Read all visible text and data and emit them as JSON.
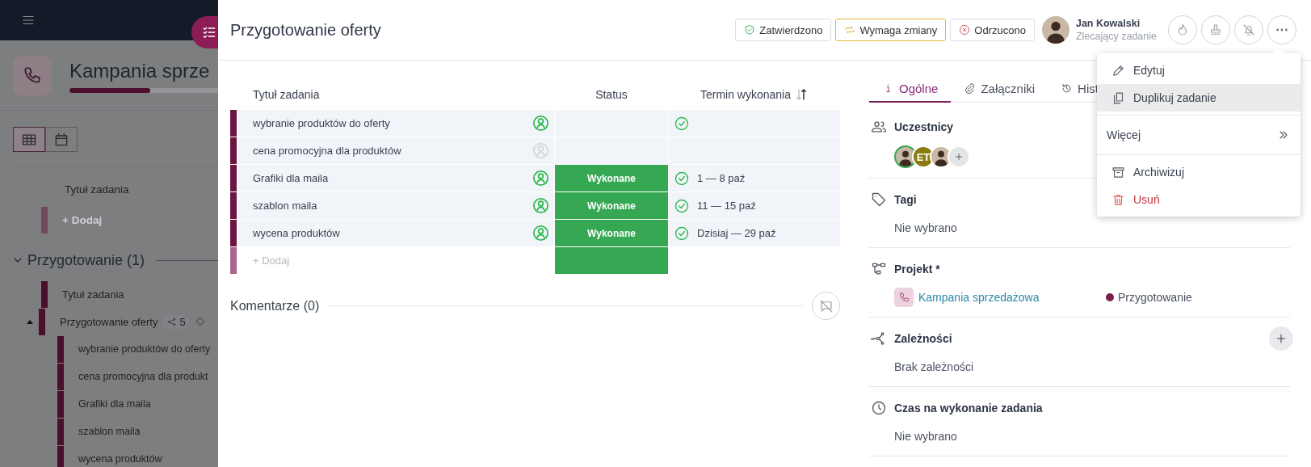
{
  "background": {
    "project_title": "Kampania sprze",
    "progress": {
      "level": 0.4
    },
    "views": [
      {
        "kind": "table",
        "selected": true
      },
      {
        "kind": "calendar",
        "selected": false
      }
    ],
    "column_header": "Tytuł zadania",
    "add_label": "+ Dodaj",
    "group": {
      "title": "Przygotowanie (1)",
      "expanded": true,
      "column_header": "Tytuł zadania",
      "task": {
        "title": "Przygotowanie oferty",
        "subtask_count": "5",
        "expanded": true,
        "children": [
          {
            "title": "wybranie produktów do oferty"
          },
          {
            "title": "cena promocyjna dla produkt"
          },
          {
            "title": "Grafiki dla maila"
          },
          {
            "title": "szablon maila"
          },
          {
            "title": "wycena produktów"
          }
        ]
      }
    }
  },
  "panel": {
    "title": "Przygotowanie oferty",
    "review_buttons": [
      {
        "kind": "approved",
        "label": "Zatwierdzono",
        "selected": false
      },
      {
        "kind": "change",
        "label": "Wymaga zmiany",
        "selected": true
      },
      {
        "kind": "rejected",
        "label": "Odrzucono",
        "selected": false
      }
    ],
    "requester": {
      "name": "Jan Kowalski",
      "role": "Zlecający zadanie"
    },
    "actions": [
      {
        "kind": "priority"
      },
      {
        "kind": "stamp"
      },
      {
        "kind": "mute"
      },
      {
        "kind": "more"
      }
    ],
    "subtasks": {
      "columns": [
        "Tytuł zadania",
        "Status",
        "Termin wykonania"
      ],
      "sort_ascending": true,
      "rows": [
        {
          "title": "wybranie produktów do oferty",
          "assigned": true,
          "done": true
        },
        {
          "title": "cena promocyjna dla produktów",
          "assigned": false,
          "done": false
        },
        {
          "title": "Grafiki dla maila",
          "assigned": true,
          "status": "Wykonane",
          "done": true,
          "due": "1 — 8 paź"
        },
        {
          "title": "szablon maila",
          "assigned": true,
          "status": "Wykonane",
          "done": true,
          "due": "11 — 15 paź"
        },
        {
          "title": "wycena produktów",
          "assigned": true,
          "status": "Wykonane",
          "done": true,
          "due": "Dzisiaj — 29 paź"
        }
      ],
      "add_row": {
        "label": "+ Dodaj",
        "status_filled": true
      }
    },
    "comments": {
      "title": "Komentarze (0)"
    },
    "tabs": [
      {
        "kind": "info",
        "label": "Ogólne",
        "selected": true
      },
      {
        "kind": "attachments",
        "label": "Załączniki",
        "selected": false
      },
      {
        "kind": "history",
        "label": "Hist",
        "selected": false
      }
    ],
    "sections": [
      {
        "kind": "participants",
        "label": "Uczestnicy",
        "add_button": true,
        "avatars": [
          {
            "kind": "photo",
            "highlighted": true
          },
          {
            "kind": "initials",
            "initials": "ET",
            "color": "#8a7b0c",
            "highlighted": false
          },
          {
            "kind": "photo",
            "highlighted": false
          }
        ]
      },
      {
        "kind": "tags",
        "label": "Tagi",
        "value": "Nie wybrano"
      },
      {
        "kind": "project",
        "label": "Projekt *",
        "project": "Kampania sprzedażowa",
        "stage": {
          "label": "Przygotowanie",
          "color": "#7b1d4c"
        }
      },
      {
        "kind": "dependencies",
        "label": "Zależności",
        "add_button": true,
        "value": "Brak zależności"
      },
      {
        "kind": "duration",
        "label": "Czas na wykonanie zadania",
        "value": "Nie wybrano"
      }
    ],
    "menu": {
      "groups": [
        [
          {
            "kind": "edit",
            "label": "Edytuj",
            "selected": false
          },
          {
            "kind": "duplicate",
            "label": "Duplikuj zadanie",
            "selected": true
          }
        ],
        [
          {
            "kind": "more",
            "label": "Więcej",
            "selected": false
          }
        ],
        [
          {
            "kind": "archive",
            "label": "Archiwizuj",
            "selected": false
          },
          {
            "kind": "delete",
            "label": "Usuń",
            "selected": false
          }
        ]
      ]
    }
  }
}
